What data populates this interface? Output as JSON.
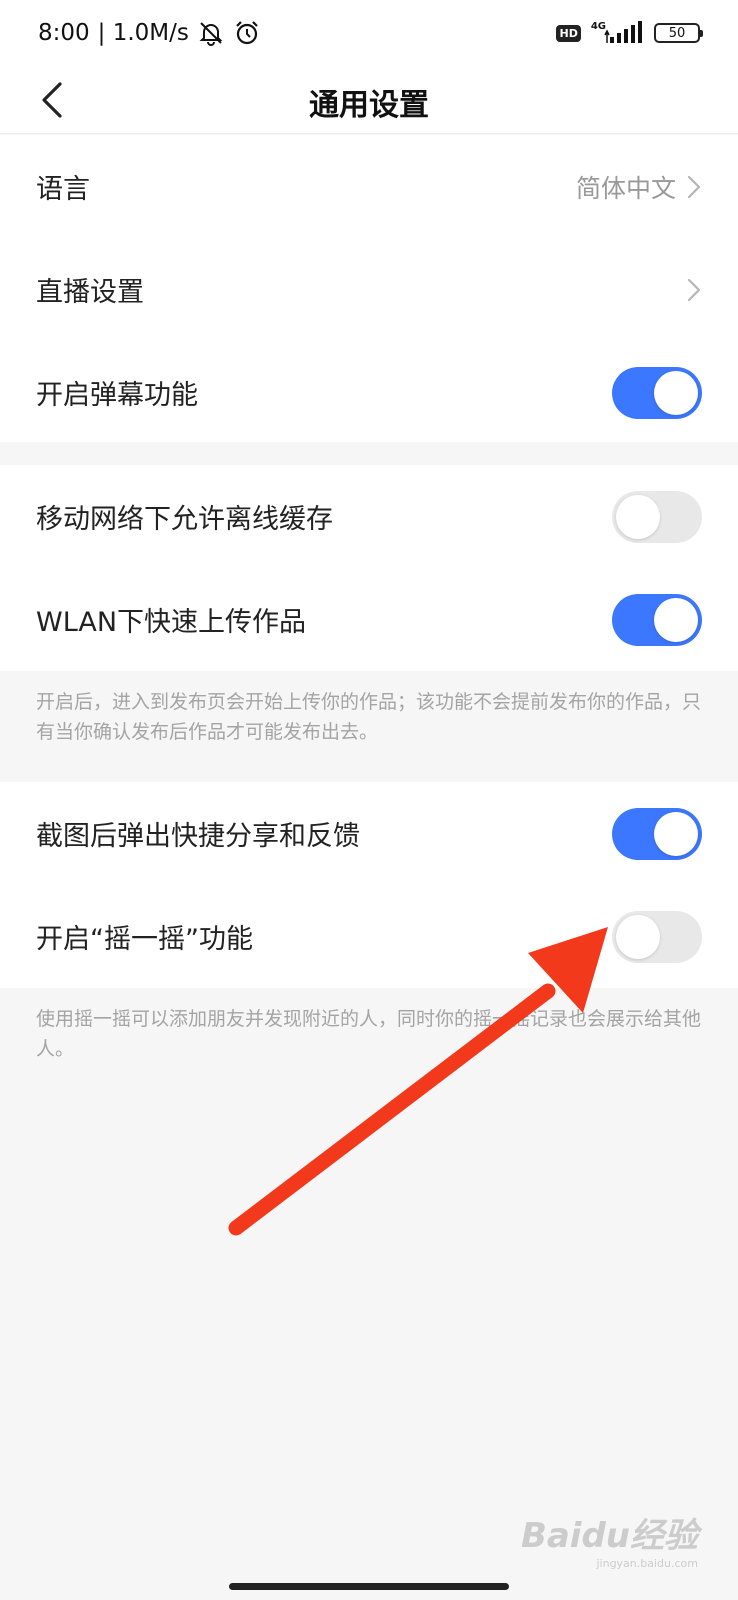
{
  "status_bar": {
    "time": "8:00",
    "network_speed": "| 1.0M/s",
    "hd_badge": "HD",
    "network_type": "4G",
    "battery": "50"
  },
  "header": {
    "title": "通用设置"
  },
  "groups": [
    {
      "rows": [
        {
          "label": "语言",
          "value": "简体中文",
          "control": "chevron"
        },
        {
          "label": "直播设置",
          "control": "chevron"
        },
        {
          "label": "开启弹幕功能",
          "control": "toggle",
          "on": true
        }
      ]
    },
    {
      "rows": [
        {
          "label": "移动网络下允许离线缓存",
          "control": "toggle",
          "on": false
        },
        {
          "label": "WLAN下快速上传作品",
          "control": "toggle",
          "on": true
        }
      ],
      "note": "开启后，进入到发布页会开始上传你的作品；该功能不会提前发布你的作品，只有当你确认发布后作品才可能发布出去。"
    },
    {
      "rows": [
        {
          "label": "截图后弹出快捷分享和反馈",
          "control": "toggle",
          "on": true
        },
        {
          "label": "开启“摇一摇”功能",
          "control": "toggle",
          "on": false
        }
      ],
      "note": "使用摇一摇可以添加朋友并发现附近的人，同时你的摇一摇记录也会展示给其他人。"
    }
  ],
  "colors": {
    "toggle_on": "#3c77ff",
    "toggle_off": "#e8e8e8",
    "annotation_arrow": "#f2391b"
  },
  "watermark": {
    "logo": "Baidu经验",
    "url": "jingyan.baidu.com"
  }
}
